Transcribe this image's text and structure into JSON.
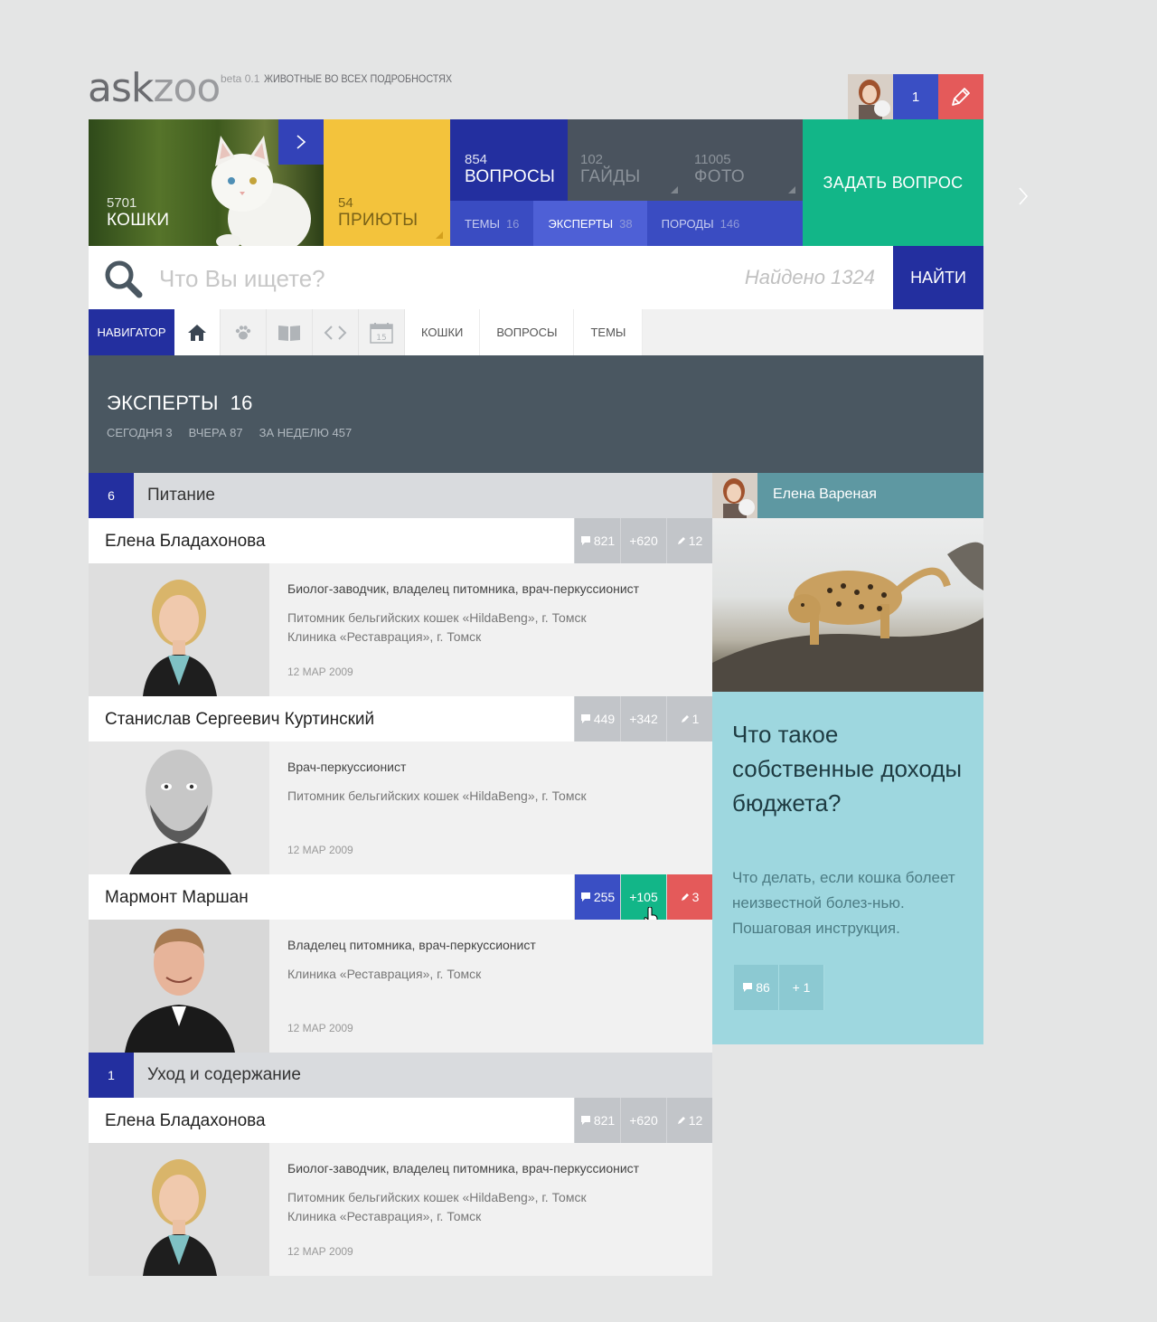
{
  "header": {
    "logo_part1": "ask",
    "logo_part2": "zoo",
    "beta": "beta 0.1",
    "tagline": "ЖИВОТНЫЕ ВО ВСЕХ ПОДРОБНОСТЯХ",
    "notifications": "1"
  },
  "tiles": {
    "cats": {
      "count": "5701",
      "label": "КОШКИ"
    },
    "shelters": {
      "count": "54",
      "label": "ПРИЮТЫ"
    },
    "questions": {
      "count": "854",
      "label": "ВОПРОСЫ"
    },
    "guides": {
      "count": "102",
      "label": "ГАЙДЫ"
    },
    "photos": {
      "count": "11005",
      "label": "ФОТО"
    },
    "ask": "ЗАДАТЬ ВОПРОС"
  },
  "subnav": [
    {
      "label": "ТЕМЫ",
      "count": "16"
    },
    {
      "label": "ЭКСПЕРТЫ",
      "count": "38"
    },
    {
      "label": "ПОРОДЫ",
      "count": "146"
    }
  ],
  "search": {
    "placeholder": "Что Вы ищете?",
    "found": "Найдено 1324",
    "button": "НАЙТИ"
  },
  "navigator": {
    "label": "НАВИГАТОР",
    "links": [
      "КОШКИ",
      "ВОПРОСЫ",
      "ТЕМЫ"
    ]
  },
  "banner": {
    "title": "ЭКСПЕРТЫ",
    "count": "16",
    "today": "СЕГОДНЯ 3",
    "yesterday": "ВЧЕРА 87",
    "week": "ЗА НЕДЕЛЮ 457"
  },
  "sections": [
    {
      "num": "6",
      "title": "Питание"
    },
    {
      "num": "1",
      "title": "Уход и содержание"
    }
  ],
  "experts": [
    {
      "name": "Елена Бладахонова",
      "answers": "821",
      "rating": "+620",
      "posts": "12",
      "role": "Биолог-заводчик, владелец питомника, врач-перкуссионист",
      "place1": "Питомник бельгийских кошек «HildaBeng», г. Томск",
      "place2": "Клиника «Реставрация», г. Томск",
      "date": "12 МАР 2009"
    },
    {
      "name": "Станислав Сергеевич Куртинский",
      "answers": "449",
      "rating": "+342",
      "posts": "1",
      "role": "Врач-перкуссионист",
      "place1": "Питомник бельгийских кошек «HildaBeng», г. Томск",
      "place2": "",
      "date": "12 МАР 2009"
    },
    {
      "name": "Мармонт Маршан",
      "answers": "255",
      "rating": "+105",
      "posts": "3",
      "role": "Владелец питомника, врач-перкуссионист",
      "place1": "Клиника «Реставрация», г. Томск",
      "place2": "",
      "date": "12 МАР 2009"
    },
    {
      "name": "Елена Бладахонова",
      "answers": "821",
      "rating": "+620",
      "posts": "12",
      "role": "Биолог-заводчик, владелец питомника, врач-перкуссионист",
      "place1": "Питомник бельгийских кошек «HildaBeng», г. Томск",
      "place2": "Клиника «Реставрация», г. Томск",
      "date": "12 МАР 2009"
    }
  ],
  "panel": {
    "user": "Елена Вареная",
    "question": "Что такое собственные доходы бюджета?",
    "text": "Что делать, если кошка болеет неизвестной болез-нью. Пошаговая инструкция.",
    "comments": "86",
    "likes": "+ 1"
  },
  "colors": {
    "accent_blue": "#232f9f",
    "blue": "#3a4fc4",
    "green": "#12b688",
    "red": "#e45a5a",
    "yellow": "#f3c33c",
    "slate": "#4a5761",
    "teal": "#9ed7df"
  }
}
